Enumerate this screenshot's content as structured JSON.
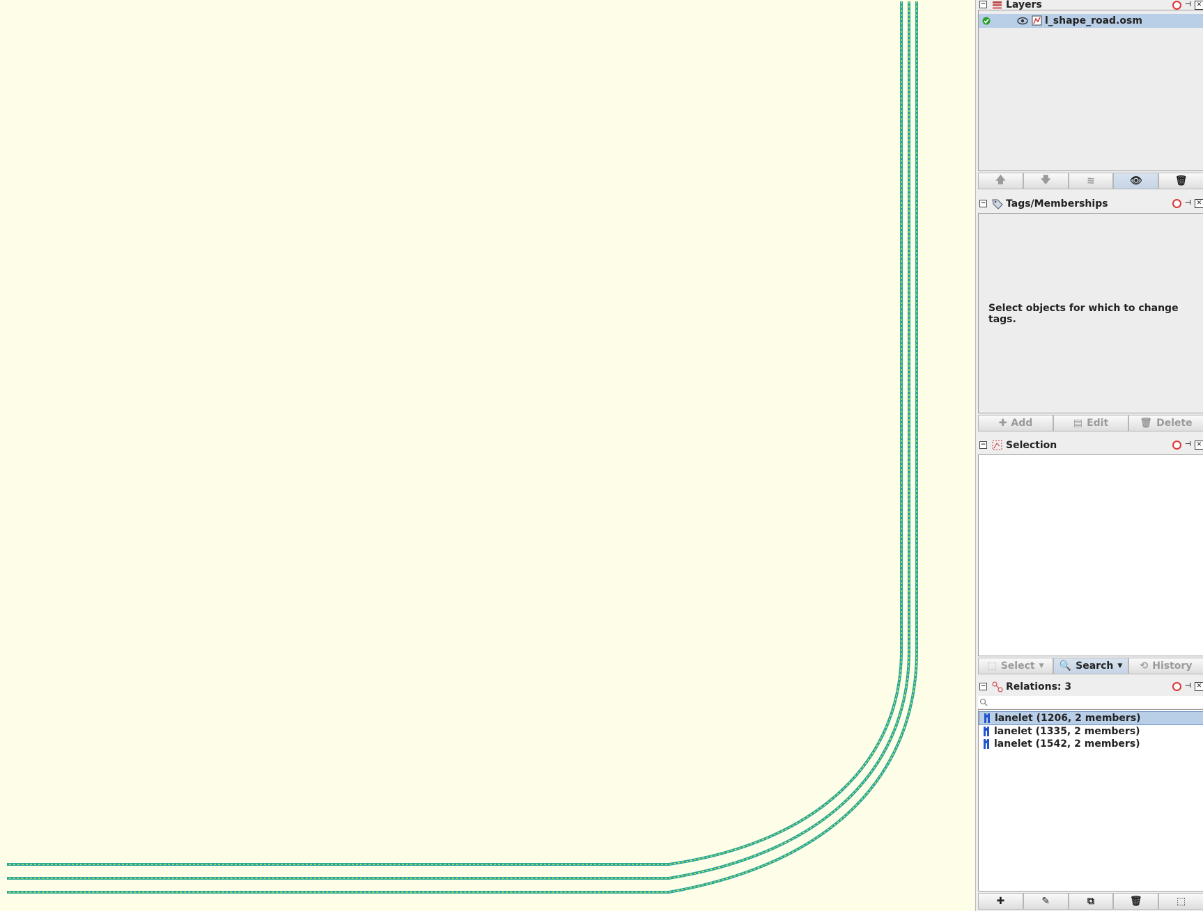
{
  "map": {
    "background": "#fefee8",
    "road_color": "#26a69a",
    "road_highlight": "#d9e84a"
  },
  "layers": {
    "title": "Layers",
    "items": [
      {
        "name": "l_shape_road.osm",
        "active": true,
        "visible": true
      }
    ],
    "buttons": [
      "arrow-up-icon",
      "arrow-down-icon",
      "merge-icon",
      "eye-icon",
      "trash-icon"
    ]
  },
  "tags": {
    "title": "Tags/Memberships",
    "empty_hint": "Select objects for which to change tags.",
    "buttons": {
      "add": "Add",
      "edit": "Edit",
      "delete": "Delete"
    }
  },
  "selection": {
    "title": "Selection",
    "buttons": {
      "select": "Select",
      "search": "Search",
      "history": "History"
    }
  },
  "relations": {
    "title": "Relations: 3",
    "filter_value": "",
    "items": [
      {
        "label": "lanelet (1206, 2 members)",
        "selected": true
      },
      {
        "label": "lanelet (1335, 2 members)",
        "selected": false
      },
      {
        "label": "lanelet (1542, 2 members)",
        "selected": false
      }
    ]
  }
}
